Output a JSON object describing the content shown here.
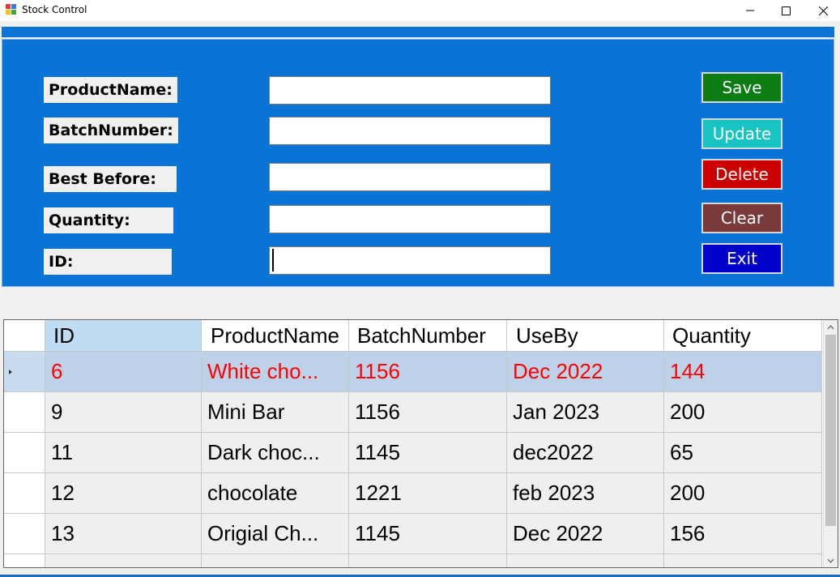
{
  "window": {
    "title": "Stock Control",
    "controls": [
      "minimize-icon",
      "maximize-icon",
      "close-icon"
    ]
  },
  "form": {
    "labels": {
      "product_name": "ProductName:",
      "batch_number": "BatchNumber:",
      "best_before": "Best Before:",
      "quantity": "Quantity:",
      "id": "ID:"
    },
    "fields": {
      "product_name": "",
      "batch_number": "",
      "best_before": "",
      "quantity": "",
      "id": ""
    }
  },
  "buttons": {
    "save": "Save",
    "update": "Update",
    "delete": "Delete",
    "clear": "Clear",
    "exit": "Exit"
  },
  "colors": {
    "panel": "#0a73d6",
    "save": "#0b7d12",
    "update": "#18c3c3",
    "delete": "#cc0000",
    "clear": "#7a3a3a",
    "exit": "#0000c8",
    "selected_row": "#bdd1e9",
    "selected_text": "#ff0000"
  },
  "grid": {
    "columns": [
      "ID",
      "ProductName",
      "BatchNumber",
      "UseBy",
      "Quantity"
    ],
    "rows": [
      [
        "6",
        "White cho...",
        "1156",
        "Dec 2022",
        "144"
      ],
      [
        "9",
        "Mini Bar",
        "1156",
        "Jan 2023",
        "200"
      ],
      [
        "11",
        "Dark choc...",
        "1145",
        "dec2022",
        "65"
      ],
      [
        "12",
        "chocolate",
        "1221",
        "feb 2023",
        "200"
      ],
      [
        "13",
        "Origial Ch...",
        "1145",
        "Dec 2022",
        "156"
      ]
    ],
    "selected_row": 0
  }
}
